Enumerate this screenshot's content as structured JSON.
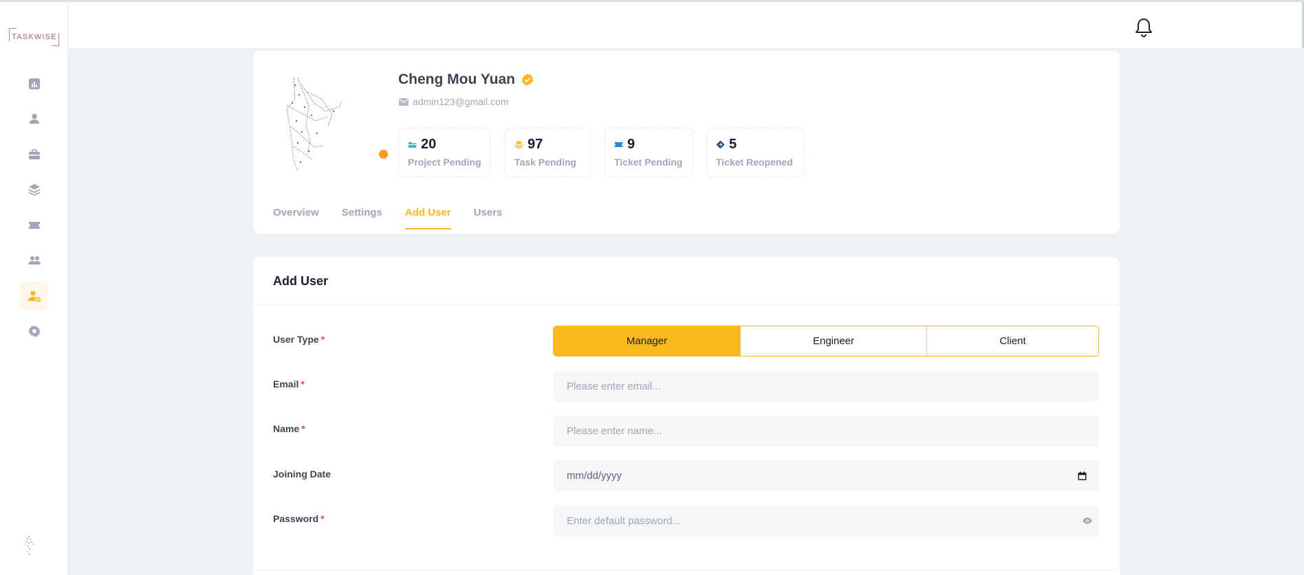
{
  "brand": {
    "logo_text": "TASKWISE"
  },
  "sidebar": {
    "items": [
      {
        "icon": "chart-icon",
        "active": false
      },
      {
        "icon": "user-icon",
        "active": false
      },
      {
        "icon": "briefcase-icon",
        "active": false
      },
      {
        "icon": "layers-icon",
        "active": false
      },
      {
        "icon": "ticket-icon",
        "active": false
      },
      {
        "icon": "users-icon",
        "active": false
      },
      {
        "icon": "user-add-icon",
        "active": true
      },
      {
        "icon": "gear-icon",
        "active": false
      }
    ]
  },
  "header": {
    "icon": "bell-icon"
  },
  "profile": {
    "name": "Cheng Mou Yuan",
    "email": "admin123@gmail.com",
    "status_color": "#ff9a1a",
    "stats": [
      {
        "value": "20",
        "label": "Project Pending",
        "icon": "folder-icon",
        "color": "#1fc1b4"
      },
      {
        "value": "97",
        "label": "Task Pending",
        "icon": "layers-icon",
        "color": "#fbb819"
      },
      {
        "value": "9",
        "label": "Ticket Pending",
        "icon": "ticket-icon",
        "color": "#1e88e5"
      },
      {
        "value": "5",
        "label": "Ticket Reopened",
        "icon": "diamond-icon",
        "color": "#1b4f8a"
      }
    ],
    "tabs": [
      {
        "label": "Overview",
        "active": false
      },
      {
        "label": "Settings",
        "active": false
      },
      {
        "label": "Add User",
        "active": true
      },
      {
        "label": "Users",
        "active": false
      }
    ]
  },
  "form": {
    "title": "Add User",
    "user_type": {
      "label": "User Type",
      "required_mark": "*",
      "options": [
        "Manager",
        "Engineer",
        "Client"
      ],
      "selected": "Manager"
    },
    "email": {
      "label": "Email",
      "required_mark": "*",
      "placeholder": "Please enter email..."
    },
    "name": {
      "label": "Name",
      "required_mark": "*",
      "placeholder": "Please enter name..."
    },
    "joining_date": {
      "label": "Joining Date",
      "value": "mm/dd/yyyy"
    },
    "password": {
      "label": "Password",
      "required_mark": "*",
      "placeholder": "Enter default password..."
    }
  },
  "colors": {
    "accent": "#fbb819",
    "required": "#f1416c",
    "muted": "#a1a5b7"
  }
}
